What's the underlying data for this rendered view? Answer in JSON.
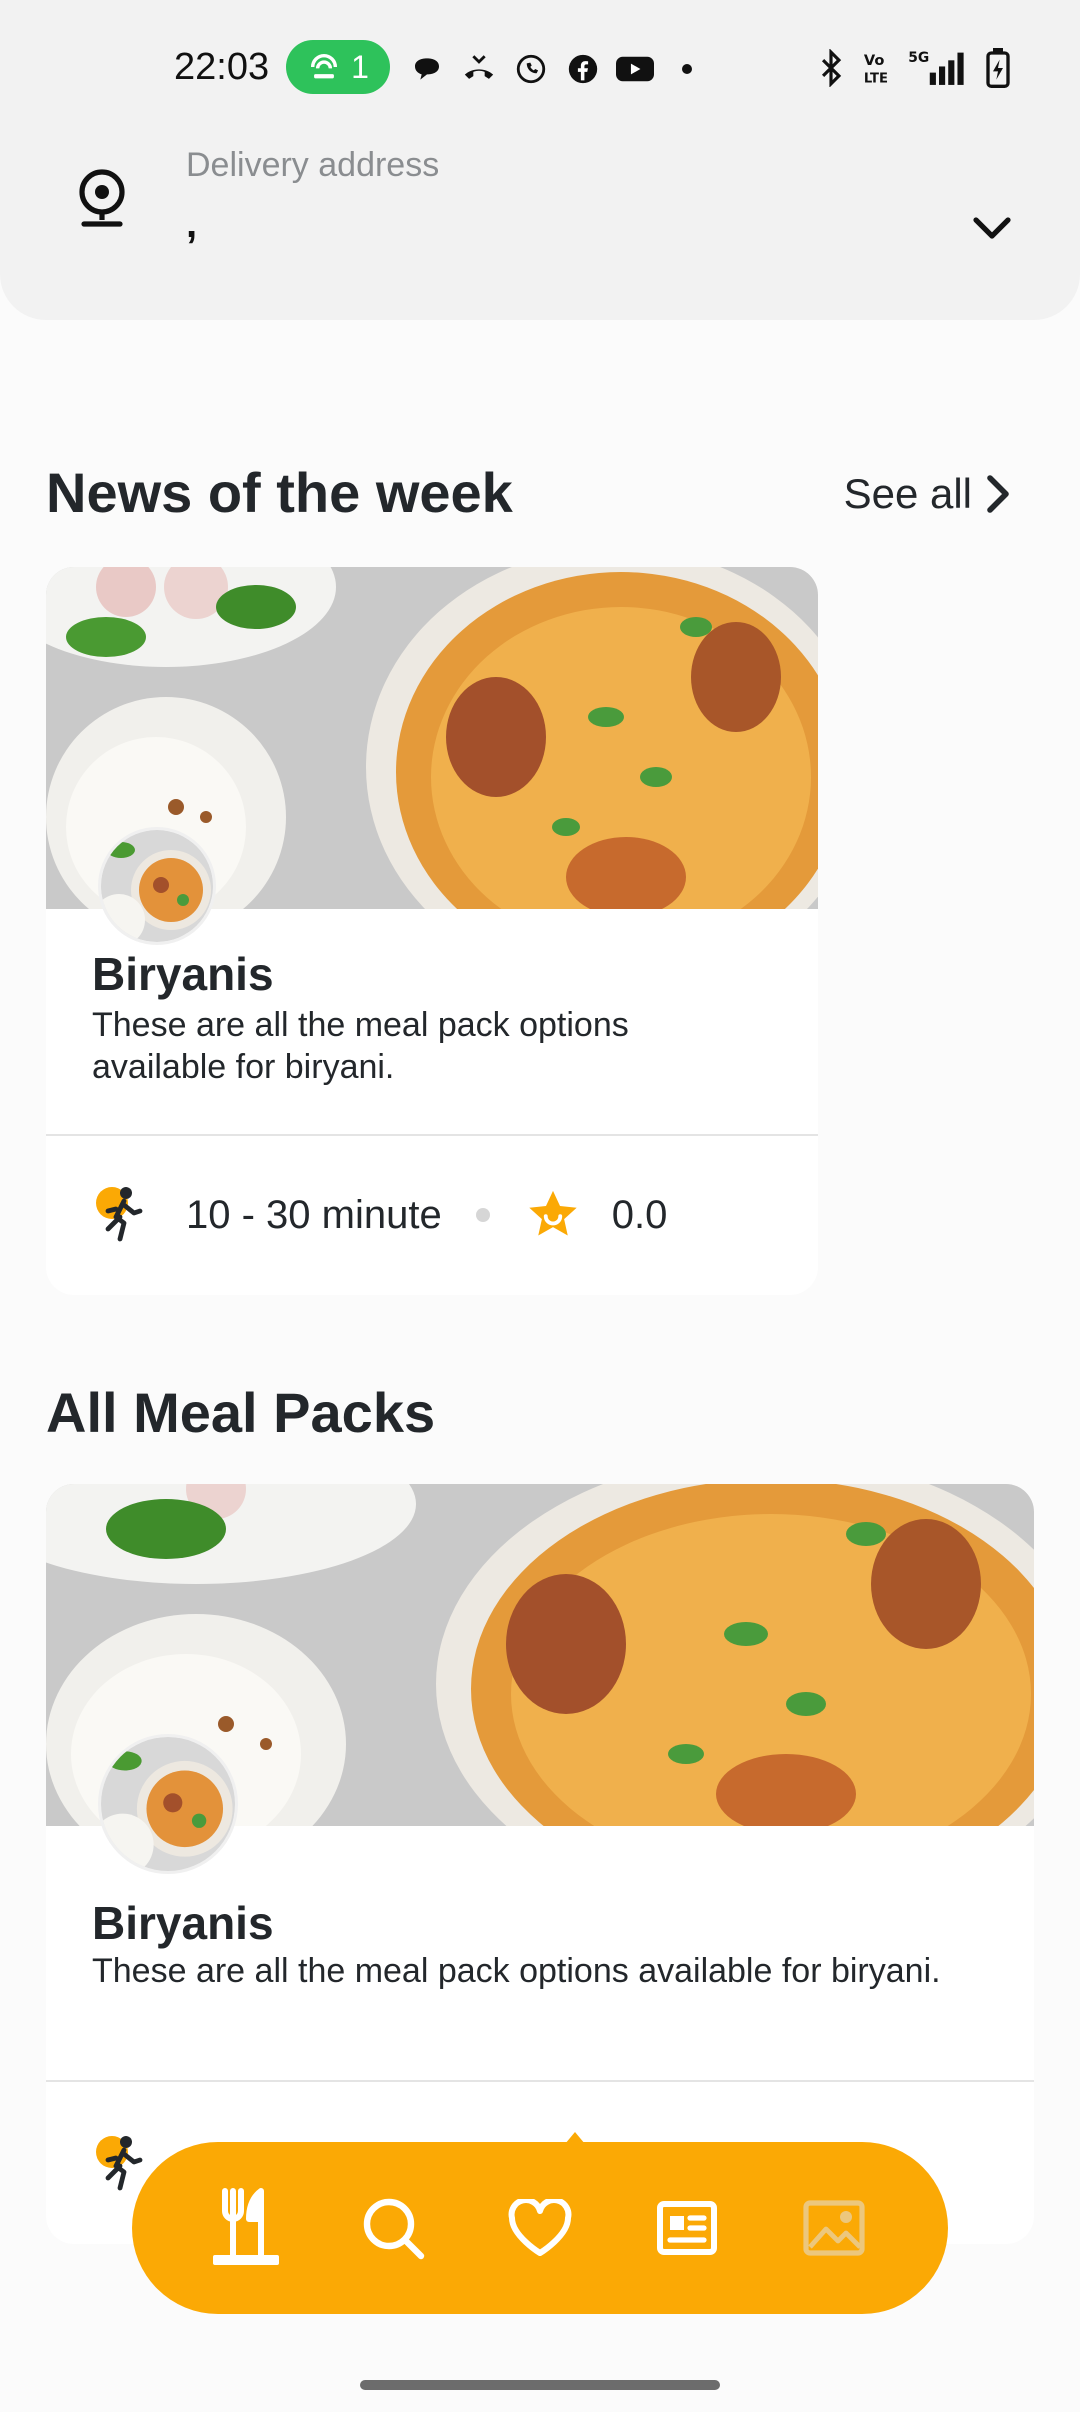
{
  "status_bar": {
    "time": "22:03",
    "hotspot_count": "1",
    "network_label": "5G",
    "volte_label": "Vo LTE"
  },
  "address": {
    "label": "Delivery address",
    "value": ","
  },
  "news": {
    "title": "News of the week",
    "see_all": "See all",
    "card": {
      "name": "Biryanis",
      "description": "These are all the meal pack options available for biryani.",
      "delivery_time": "10 - 30 minute",
      "rating": "0.0"
    }
  },
  "all_meal_packs": {
    "title": "All Meal Packs",
    "card": {
      "name": "Biryanis",
      "description": "These are all the meal pack options available for biryani."
    }
  },
  "bottom_nav": {
    "items": [
      "restaurant-icon",
      "search-icon",
      "heart-icon",
      "news-icon",
      "gallery-icon"
    ],
    "accent_color": "#fba905"
  },
  "colors": {
    "accent": "#fba905",
    "hotspot": "#2ec25b",
    "text": "#23272b",
    "muted": "#8a8d90"
  }
}
